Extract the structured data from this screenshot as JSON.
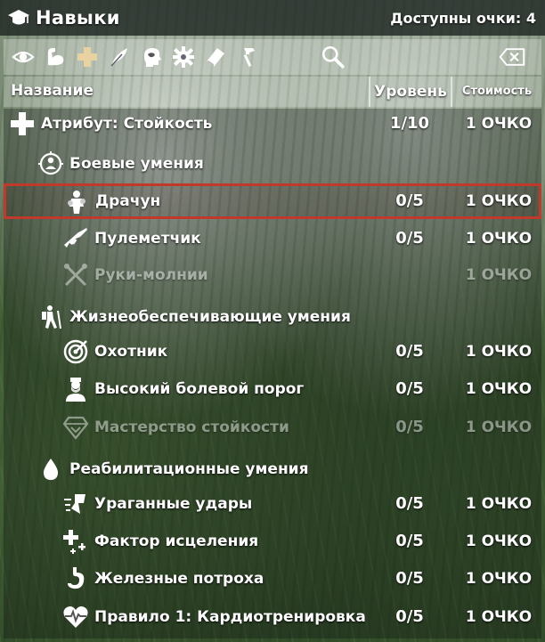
{
  "window": {
    "title": "Навыки",
    "available_points": "Доступны очки: 4",
    "title_icon": "graduation-cap-icon"
  },
  "toolbar": {
    "category_icons": [
      "eye-icon",
      "muscle-arm-icon",
      "plus-cross-icon",
      "feather-icon",
      "brain-head-icon",
      "gear-icon",
      "book-icon",
      "hammer-icon"
    ],
    "search_icon": "magnifier-icon",
    "search_value": "",
    "clear_icon": "backspace-icon"
  },
  "columns": {
    "name": "Название",
    "level": "Уровень",
    "cost": "Стоимость"
  },
  "rows": [
    {
      "kind": "attribute",
      "icon": "plus-cross-icon",
      "name": "Атрибут: Стойкость",
      "level": "1/10",
      "cost": "1 ОЧКО"
    },
    {
      "kind": "group",
      "icon": "crosshair-person-icon",
      "name": "Боевые умения",
      "level": "",
      "cost": ""
    },
    {
      "kind": "perk",
      "icon": "brawler-icon",
      "name": "Драчун",
      "level": "0/5",
      "cost": "1 ОЧКО",
      "selected": true
    },
    {
      "kind": "perk",
      "icon": "machine-gun-icon",
      "name": "Пулеметчик",
      "level": "0/5",
      "cost": "1 ОЧКО"
    },
    {
      "kind": "perk",
      "icon": "crossed-knuckles-icon",
      "name": "Руки-молнии",
      "level": "",
      "cost": "1 ОЧКО",
      "locked": true
    },
    {
      "kind": "group",
      "icon": "hiker-icon",
      "name": "Жизнеобеспечивающие умения",
      "level": "",
      "cost": ""
    },
    {
      "kind": "perk",
      "icon": "target-icon",
      "name": "Охотник",
      "level": "0/5",
      "cost": "1 ОЧКО"
    },
    {
      "kind": "perk",
      "icon": "bearded-man-icon",
      "name": "Высокий болевой порог",
      "level": "0/5",
      "cost": "1 ОЧКО"
    },
    {
      "kind": "perk",
      "icon": "diamond-skill-icon",
      "name": "Мастерство стойкости",
      "level": "0/5",
      "cost": "1 ОЧКО",
      "locked": true
    },
    {
      "kind": "group",
      "icon": "droplet-icon",
      "name": "Реабилитационные умения",
      "level": "",
      "cost": ""
    },
    {
      "kind": "perk",
      "icon": "fast-strike-icon",
      "name": "Ураганные удары",
      "level": "0/5",
      "cost": "1 ОЧКО"
    },
    {
      "kind": "perk",
      "icon": "healing-plus-icon",
      "name": "Фактор исцеления",
      "level": "0/5",
      "cost": "1 ОЧКО"
    },
    {
      "kind": "perk",
      "icon": "stomach-icon",
      "name": "Железные потроха",
      "level": "0/5",
      "cost": "1 ОЧКО"
    },
    {
      "kind": "perk",
      "icon": "heartbeat-icon",
      "name": "Правило 1: Кардиотренировка",
      "level": "0/5",
      "cost": "1 ОЧКО"
    }
  ],
  "colors": {
    "selection_border": "#c0392b",
    "text": "#ffffff"
  }
}
